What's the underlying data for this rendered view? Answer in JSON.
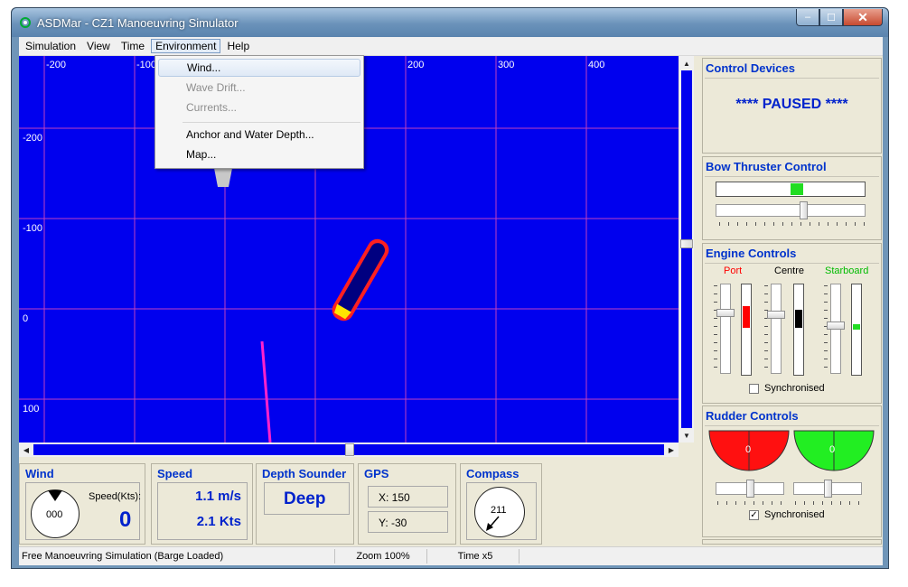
{
  "window": {
    "title": "ASDMar - CZ1 Manoeuvring Simulator",
    "min": "–",
    "max": "☐",
    "close": "✕"
  },
  "menu": [
    {
      "label": "Simulation"
    },
    {
      "label": "View"
    },
    {
      "label": "Time"
    },
    {
      "label": "Environment"
    },
    {
      "label": "Help"
    }
  ],
  "environment_menu": [
    {
      "label": "Wind...",
      "state": "hover"
    },
    {
      "label": "Wave Drift...",
      "state": "disabled"
    },
    {
      "label": "Currents...",
      "state": "disabled"
    },
    {
      "label": "Anchor and Water Depth...",
      "state": "enabled"
    },
    {
      "label": "Map...",
      "state": "enabled"
    }
  ],
  "map": {
    "x_labels": [
      "-200",
      "-100",
      "200",
      "300",
      "400"
    ],
    "y_labels": [
      "-200",
      "-100",
      "0",
      "100"
    ],
    "colors": {
      "water": "#0000ee",
      "grid": "#c040c0",
      "ship_hull": "#000080",
      "ship_outline": "#ff2020",
      "track": "#ff22cc"
    }
  },
  "control_devices": {
    "title": "Control Devices",
    "status": "**** PAUSED ****"
  },
  "bow_thruster": {
    "title": "Bow Thruster Control",
    "level": 0.5
  },
  "engine_controls": {
    "title": "Engine Controls",
    "engines": [
      {
        "label": "Port",
        "color": "#ff0000"
      },
      {
        "label": "Centre",
        "color": "#000000"
      },
      {
        "label": "Starboard",
        "color": "#00cc00"
      }
    ],
    "synchronised": "Synchronised"
  },
  "rudder_controls": {
    "title": "Rudder Controls",
    "port_value": "0",
    "starboard_value": "0",
    "synchronised": "Synchronised"
  },
  "wind": {
    "title": "Wind",
    "dial_value": "000",
    "speed_label": "Speed(Kts):",
    "speed_value": "0"
  },
  "speed": {
    "title": "Speed",
    "ms": "1.1 m/s",
    "kts": "2.1 Kts"
  },
  "depth": {
    "title": "Depth Sounder",
    "value": "Deep"
  },
  "gps": {
    "title": "GPS",
    "x": "X: 150",
    "y": "Y: -30"
  },
  "compass": {
    "title": "Compass",
    "value": "211"
  },
  "status": {
    "mode": "Free Manoeuvring Simulation (Barge Loaded)",
    "zoom": "Zoom 100%",
    "time": "Time x5"
  }
}
